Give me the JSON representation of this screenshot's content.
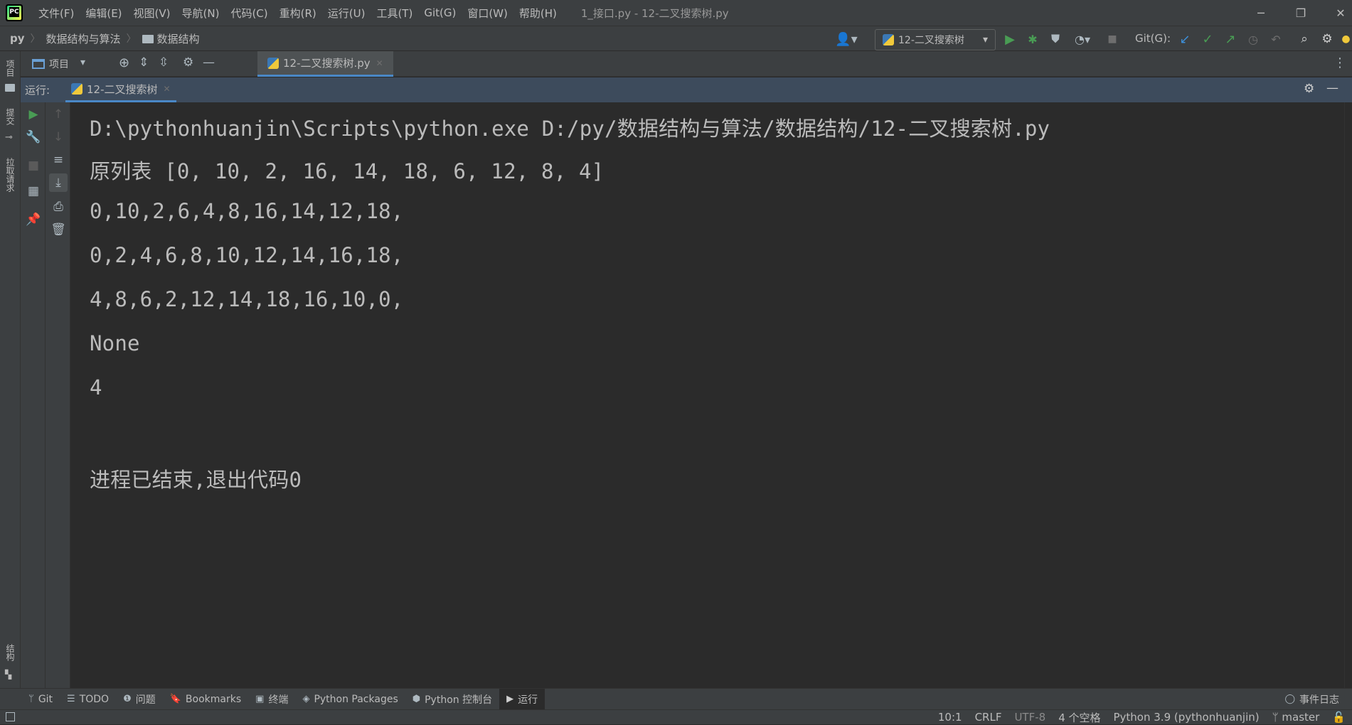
{
  "menu": {
    "items": [
      "文件(F)",
      "编辑(E)",
      "视图(V)",
      "导航(N)",
      "代码(C)",
      "重构(R)",
      "运行(U)",
      "工具(T)",
      "Git(G)",
      "窗口(W)",
      "帮助(H)"
    ],
    "window_title": "1_接口.py - 12-二叉搜索树.py"
  },
  "breadcrumb": {
    "root": "py",
    "folder1": "数据结构与算法",
    "folder2": "数据结构"
  },
  "run_config": {
    "name": "12-二叉搜索树"
  },
  "git": {
    "label": "Git(G):"
  },
  "project_panel": {
    "label": "项目"
  },
  "editor_tab": {
    "label": "12-二叉搜索树.py"
  },
  "run_panel": {
    "prefix": "运行:",
    "tab_label": "12-二叉搜索树"
  },
  "left_stripe": {
    "project": "项目",
    "commit": "提交",
    "pull_requests": "拉取请求",
    "structure": "结构"
  },
  "console": {
    "lines": [
      "D:\\pythonhuanjin\\Scripts\\python.exe D:/py/数据结构与算法/数据结构/12-二叉搜索树.py",
      "原列表 [0, 10, 2, 16, 14, 18, 6, 12, 8, 4]",
      "0,10,2,6,4,8,16,14,12,18,",
      "0,2,4,6,8,10,12,14,16,18,",
      "4,8,6,2,12,14,18,16,10,0,",
      "None",
      "4",
      "",
      "进程已结束,退出代码0"
    ]
  },
  "bottom_tools": [
    {
      "label": "Git",
      "icon": "git-branch-icon"
    },
    {
      "label": "TODO",
      "icon": "todo-list-icon"
    },
    {
      "label": "问题",
      "icon": "problems-icon"
    },
    {
      "label": "Bookmarks",
      "icon": "bookmark-icon"
    },
    {
      "label": "终端",
      "icon": "terminal-icon"
    },
    {
      "label": "Python Packages",
      "icon": "packages-icon"
    },
    {
      "label": "Python 控制台",
      "icon": "python-console-icon"
    },
    {
      "label": "运行",
      "icon": "run-icon"
    }
  ],
  "event_log": {
    "label": "事件日志"
  },
  "status": {
    "position": "10:1",
    "line_sep": "CRLF",
    "encoding": "UTF-8",
    "indent": "4 个空格",
    "interpreter": "Python 3.9 (pythonhuanjin)",
    "branch": "master"
  },
  "colors": {
    "bg": "#2b2b2b",
    "panel": "#3c3f41",
    "run_header": "#3d4b5c",
    "accent": "#4a88c7",
    "run_green": "#499c54"
  }
}
